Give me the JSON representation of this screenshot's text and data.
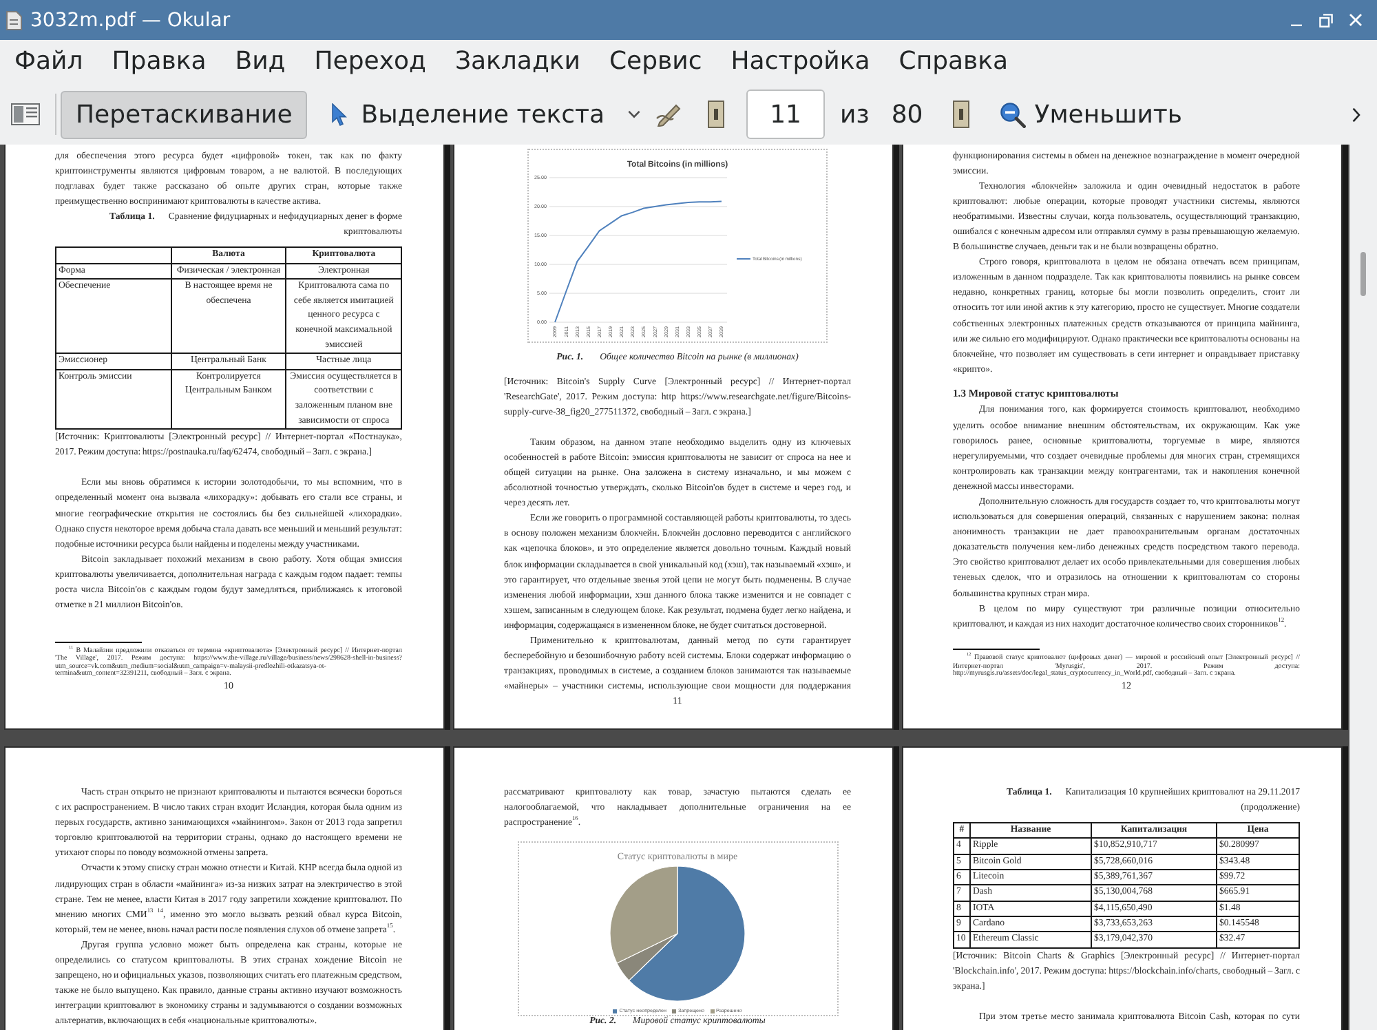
{
  "window": {
    "title": "3032m.pdf — Okular"
  },
  "menu": [
    "Файл",
    "Правка",
    "Вид",
    "Переход",
    "Закладки",
    "Сервис",
    "Настройка",
    "Справка"
  ],
  "toolbar": {
    "tools": [
      {
        "kind": "browse",
        "label": "Перетаскивание",
        "selected": true
      },
      {
        "kind": "select",
        "label": "Выделение текста",
        "selected": false
      }
    ],
    "page": {
      "value": "11",
      "of": "из",
      "total": "80"
    },
    "zoom_out": "Уменьшить"
  },
  "pages": [
    {
      "number": "10",
      "blocks": [
        {
          "kind": "continuation",
          "text": "для обеспечения этого ресурса будет «цифровой» токен, так как по факту криптоинструменты являются цифровым товаром, а не валютой. В последующих подглавах будет также рассказано об опыте других стран, которые также преимущественно воспринимают криптовалюты в качестве актива."
        },
        {
          "kind": "table_caption",
          "label": "Таблица 1.",
          "text": "Сравнение фидуциарных и нефидуциарных денег в форме криптовалюты"
        },
        {
          "kind": "comparison_table",
          "columns": [
            "Валюта",
            "Криптовалюта"
          ],
          "rows": [
            {
              "label": "Форма",
              "cells": [
                "Физическая / электронная",
                "Электронная"
              ]
            },
            {
              "label": "Обеспечение",
              "cells": [
                "В настоящее время не обеспечена",
                "Криптовалюта сама по себе является имитацией ценного ресурса с конечной максимальной эмиссией"
              ]
            },
            {
              "label": "Эмиссионер",
              "cells": [
                "Центральный Банк",
                "Частные лица"
              ]
            },
            {
              "label": "Контроль эмиссии",
              "cells": [
                "Контролируется Центральным Банком",
                "Эмиссия осуществляется в соответствии с заложенным планом вне зависимости от спроса"
              ]
            }
          ]
        },
        {
          "kind": "source",
          "text": "[Источник: Криптовалюты [Электронный ресурс] // Интернет-портал «Постнаука», 2017. Режим доступа: https://postnauka.ru/faq/62474, свободный – Загл. с экрана.]"
        },
        {
          "kind": "paragraph",
          "text": "Если мы вновь обратимся к истории золотодобычи, то мы вспомним, что в определенный момент она вызвала «лихорадку»: добывать его стали все страны, и многие географические открытия не состоялись бы без сильнейшей «лихорадки». Однако спустя некоторое время добыча стала давать все меньший и меньший результат: подобные источники ресурса были найдены и поделены между участниками."
        },
        {
          "kind": "paragraph",
          "text": "Bitcoin закладывает похожий механизм в свою работу. Хотя общая эмиссия криптовалюты увеличивается, дополнительная награда с каждым годом падает: темпы роста числа Bitcoin'ов с каждым годом будут замедляться, приближаясь к итоговой отметке в 21 миллион Bitcoin'ов."
        }
      ],
      "footnotes": [
        "$^{11}$ В Малайзии предложили отказаться от термина «криптовалюта» [Электронный ресурс] // Интернет-портал 'The Village', 2017. Режим доступа: https://www.the-village.ru/village/business/news/298628-shell-in-business?utm_source=vk.com&utm_medium=social&utm_campaign=v-malaysii-predlozhili-otkazatsya-ot-termina&utm_content=32391211, свободный – Загл. с экрана."
      ]
    },
    {
      "number": "11",
      "blocks": [
        {
          "kind": "line_figure",
          "chart_data": {
            "type": "line",
            "title": "Total Bitcoins (in millions)",
            "categories": [
              "2009",
              "2011",
              "2013",
              "2015",
              "2017",
              "2019",
              "2021",
              "2023",
              "2025",
              "2027",
              "2029",
              "2031",
              "2033",
              "2035",
              "2037",
              "2039"
            ],
            "series": [
              {
                "name": "Total Bitcoins (in millions)",
                "color": "#4f81bd",
                "values": [
                  0,
                  5.3,
                  10.5,
                  13.1,
                  15.8,
                  17.1,
                  18.4,
                  19,
                  19.7,
                  20,
                  20.3,
                  20.5,
                  20.7,
                  20.8,
                  20.8,
                  20.9
                ]
              }
            ],
            "ylim": [
              0,
              25
            ],
            "yticks": [
              {
                "value": 0,
                "label": "0.00"
              },
              {
                "value": 5,
                "label": "5.00"
              },
              {
                "value": 10,
                "label": "10.00"
              },
              {
                "value": 15,
                "label": "15.00"
              },
              {
                "value": 20,
                "label": "20.00"
              },
              {
                "value": 25,
                "label": "25.00"
              }
            ],
            "grid": true
          }
        },
        {
          "kind": "figure_caption",
          "label": "Рис. 1.",
          "text": "Общее количество Bitcoin на рынке (в миллионах)"
        },
        {
          "kind": "source",
          "text": "[Источник: Bitcoin's Supply Curve [Электронный ресурс] // Интернет-портал 'ResearchGate', 2017. Режим доступа: http https://www.researchgate.net/figure/Bitcoins-supply-curve-38_fig20_277511372, свободный – Загл. с экрана.]"
        },
        {
          "kind": "paragraph",
          "text": "Таким образом, на данном этапе необходимо выделить одну из ключевых особенностей в работе Bitcoin: эмиссия криптовалюты не зависит от спроса на нее и общей ситуации на рынке. Она заложена в систему изначально, и мы можем с абсолютной точностью утверждать, сколько Bitcoin'ов будет в системе и через год, и через десять лет."
        },
        {
          "kind": "paragraph",
          "text": "Если же говорить о программной составляющей работы криптовалюты, то здесь в основу положен механизм блокчейн. Блокчейн дословно переводится с английского как «цепочка блоков», и это определение является довольно точным. Каждый новый блок информации складывается в свой уникальный код (хэш), так называемый «хэш», и это гарантирует, что отдельные звенья этой цепи не могут быть подменены. В случае изменения любой информации, хэш данного блока также изменится и не совпадет с хэшем, записанным в следующем блоке. Как результат, подмена будет легко найдена, и информация, содержащаяся в измененном блоке, не будет считаться достоверной."
        },
        {
          "kind": "runover",
          "text": "Применительно к криптовалютам, данный метод по сути гарантирует бесперебойную и безошибочную работу всей системы. Блоки содержат информацию о транзакциях, проводимых в системе, а созданием блоков занимаются так называемые «майнеры» – участники системы, использующие свои мощности для поддержания"
        }
      ]
    },
    {
      "number": "12",
      "blocks": [
        {
          "kind": "continuation",
          "text": "функционирования системы в обмен на денежное вознаграждение в момент очередной эмиссии."
        },
        {
          "kind": "paragraph",
          "text": "Технология «блокчейн» заложила и один очевидный недостаток в работе криптовалют: любые операции, которые проводят участники системы, являются необратимыми. Известны случаи, когда пользователь, осуществляющий транзакцию, ошибался с конечным адресом или отправлял сумму в разы превышающую желаемую. В большинстве случаев, деньги так и не были возвращены обратно."
        },
        {
          "kind": "paragraph",
          "text": "Строго говоря, криптовалюта в целом не обязана отвечать всем принципам, изложенным в данном подразделе. Так как криптовалюты появились на рынке совсем недавно, конкретных границ, которые бы могли позволить определить, стоит ли относить тот или иной актив к эту категорию, просто не существует. Многие создатели собственных электронных платежных средств отказываются от принципа майнинга, или же сильно его модифицируют. Однако практически все криптовалюты основаны на блокчейне, что позволяет им существовать в сети интернет и оправдывает приставку «крипто»."
        },
        {
          "kind": "heading",
          "text": "1.3 Мировой статус криптовалюты"
        },
        {
          "kind": "paragraph",
          "text": "Для понимания того, как формируется стоимость криптовалют, необходимо уделить особое внимание внешним обстоятельствам, их окружающим. Как уже говорилось ранее, основные криптовалюты, торгуемые в мире, являются нерегулируемыми, что создает очевидные проблемы для многих стран, стремящихся контролировать как транзакции между контрагентами, так и накопления конечной денежной массы инвесторами."
        },
        {
          "kind": "paragraph",
          "text": "Дополнительную сложность для государств создает то, что криптовалюты могут использоваться для совершения операций, связанных с нарушением закона: полная анонимность транзакции не дает правоохранительным органам достаточных доказательств получения кем-либо денежных средств посредством такого перевода. Это свойство криптовалют делает их особо привлекательными для совершения любых теневых сделок, что и отразилось на отношении к криптовалютам со стороны большинства крупных стран мира."
        },
        {
          "kind": "paragraph",
          "text": "В целом по миру существуют три различные позиции относительно криптовалют, и каждая из них находит достаточное количество своих сторонников$^{12}$."
        }
      ],
      "footnotes": [
        "$^{12}$ Правовой статус криптовалют (цифровых денег) — мировой и российский опыт [Электронный ресурс] // Интернет-портал 'Myrusgis', 2017. Режим доступа: http://myrusgis.ru/assets/doc/legal_status_cryptocurrency_in_World.pdf, свободный – Загл. с экрана."
      ]
    },
    {
      "blocks": [
        {
          "kind": "paragraph",
          "text": "Часть стран открыто не признают криптовалюты и пытаются всячески бороться с их распространением. В число таких стран входит Исландия, которая была одним из первых государств, активно занимающихся «майнингом». Закон от 2013 года запретил торговлю криптовалютой на территории страны, однако до настоящего времени не утихают споры по поводу возможной отмены запрета."
        },
        {
          "kind": "paragraph",
          "text": "Отчасти к этому списку стран можно отнести и Китай. КНР всегда была одной из лидирующих стран в области «майнинга» из-за низких затрат на электричество в этой стране. Тем не менее, власти Китая в 2017 году запретили хождение криптовалют. По мнению многих СМИ$^{13 14}$, именно это могло вызвать резкий обвал курса Bitcoin, который, тем не менее, вновь начал расти после появления слухов об отмене запрета$^{15}$."
        },
        {
          "kind": "paragraph",
          "text": "Другая группа условно может быть определена как страны, которые не определились со статусом криптовалюты. В этих странах хождение Bitcoin не запрещено, но и официальных указов, позволяющих считать его платежным средством, также не было выпущено. Как правило, данные страны активно изучают возможность интеграции криптовалют в экономику страны и задумываются о создании возможных альтернатив, включающих в себя «национальные криптовалюты»."
        }
      ]
    },
    {
      "blocks": [
        {
          "kind": "continuation",
          "text": "рассматривают криптовалюту как товар, зачастую пытаются сделать ее налогооблагаемой, что накладывает дополнительные ограничения на ее распространение$^{16}$."
        },
        {
          "kind": "pie_figure",
          "title": "Статус криптовалюты в мире",
          "legend": [
            {
              "label": "Статус неопределен",
              "color": "#4f7ba7"
            },
            {
              "label": "Запрещено",
              "color": "#8a877a"
            },
            {
              "label": "Разрешено",
              "color": "#a39e88"
            }
          ]
        },
        {
          "kind": "figure_caption",
          "label": "Рис. 2.",
          "text": "Мировой статус криптовалюты"
        }
      ]
    },
    {
      "blocks": [
        {
          "kind": "table_caption",
          "label": "Таблица 1.",
          "text": "Капитализация 10 крупнейших криптовалют на 29.11.2017 (продолжение)"
        },
        {
          "kind": "data_table",
          "columns": [
            "#",
            "Название",
            "Капитализация",
            "Цена"
          ],
          "rows": [
            [
              "4",
              "Ripple",
              "$10,852,910,717",
              "$0.280997"
            ],
            [
              "5",
              "Bitcoin Gold",
              "$5,728,660,016",
              "$343.48"
            ],
            [
              "6",
              "Litecoin",
              "$5,389,761,367",
              "$99.72"
            ],
            [
              "7",
              "Dash",
              "$5,130,004,768",
              "$665.91"
            ],
            [
              "8",
              "IOTA",
              "$4,115,650,490",
              "$1.48"
            ],
            [
              "9",
              "Cardano",
              "$3,733,653,263",
              "$0.145548"
            ],
            [
              "10",
              "Ethereum Classic",
              "$3,179,042,370",
              "$32.47"
            ]
          ]
        },
        {
          "kind": "source",
          "text": "[Источник: Bitcoin Charts & Graphics [Электронный ресурс] // Интернет-портал 'Blockchain.info', 2017. Режим доступа: https://blockchain.info/charts, свободный – Загл. с экрана.]"
        },
        {
          "kind": "runover",
          "text": "При этом третье место занимала криптовалюта Bitcoin Cash, которая по сути"
        }
      ]
    }
  ]
}
